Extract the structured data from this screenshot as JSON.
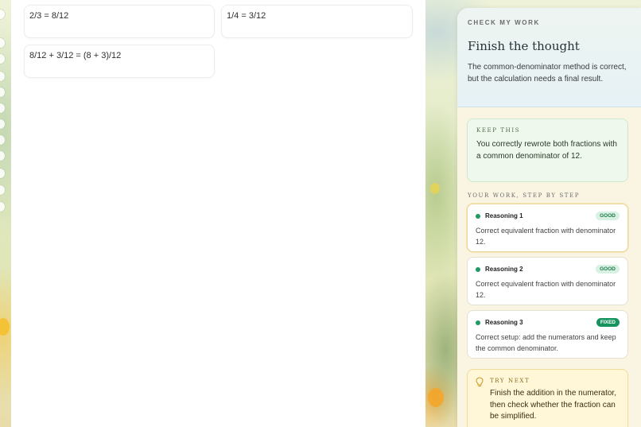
{
  "canvas": {
    "cards": [
      {
        "text": "2/3 = 8/12"
      },
      {
        "text": "1/4 = 3/12"
      },
      {
        "text": "8/12 + 3/12 = (8 + 3)/12"
      }
    ]
  },
  "panel": {
    "eyebrow": "CHECK MY WORK",
    "title": "Finish the thought",
    "subtitle": "The common-denominator method is correct, but the calculation needs a final result.",
    "keep": {
      "label": "KEEP THIS",
      "text": "You correctly rewrote both fractions with a common denominator of 12."
    },
    "steps_label": "YOUR WORK, STEP BY STEP",
    "steps": [
      {
        "title": "Reasoning 1",
        "badge": "GOOD",
        "text": "Correct equivalent fraction with denominator 12."
      },
      {
        "title": "Reasoning 2",
        "badge": "GOOD",
        "text": "Correct equivalent fraction with denominator 12."
      },
      {
        "title": "Reasoning 3",
        "badge": "FIXED",
        "text": "Correct setup: add the numerators and keep the common denominator."
      }
    ],
    "next": {
      "label": "TRY NEXT",
      "icon": "lightbulb-icon",
      "text": "Finish the addition in the numerator, then check whether the fraction can be simplified."
    }
  },
  "colors": {
    "accent_green": "#1f9a63",
    "keep_bg": "#eef8ec",
    "next_bg": "#fff7d8",
    "panel_bg": "#faf4e2"
  }
}
